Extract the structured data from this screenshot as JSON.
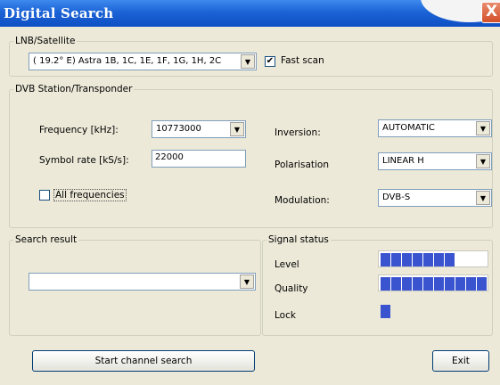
{
  "window": {
    "title": "Digital Search",
    "close_glyph": "X"
  },
  "lnb": {
    "legend": "LNB/Satellite",
    "satellite": "( 19.2° E) Astra 1B, 1C, 1E, 1F, 1G, 1H, 2C",
    "fast_scan_label": "Fast scan",
    "fast_scan_checked": "✔"
  },
  "dvb": {
    "legend": "DVB Station/Transponder",
    "frequency_label": "Frequency [kHz]:",
    "frequency_value": "10773000",
    "symbol_rate_label": "Symbol rate [kS/s]:",
    "symbol_rate_value": "22000",
    "all_frequencies_label": "All frequencies",
    "inversion_label": "Inversion:",
    "inversion_value": "AUTOMATIC",
    "polarisation_label": "Polarisation",
    "polarisation_value": "LINEAR H",
    "modulation_label": "Modulation:",
    "modulation_value": "DVB-S"
  },
  "search_result": {
    "legend": "Search result",
    "value": ""
  },
  "signal": {
    "legend": "Signal status",
    "level_label": "Level",
    "quality_label": "Quality",
    "lock_label": "Lock",
    "level_segments": 7,
    "quality_segments": 10,
    "lock_segments": 1,
    "bar_color": "#3a53cf"
  },
  "buttons": {
    "start_label": "Start channel search",
    "exit_label": "Exit"
  },
  "icons": {
    "dropdown": "▼",
    "close": "X"
  }
}
